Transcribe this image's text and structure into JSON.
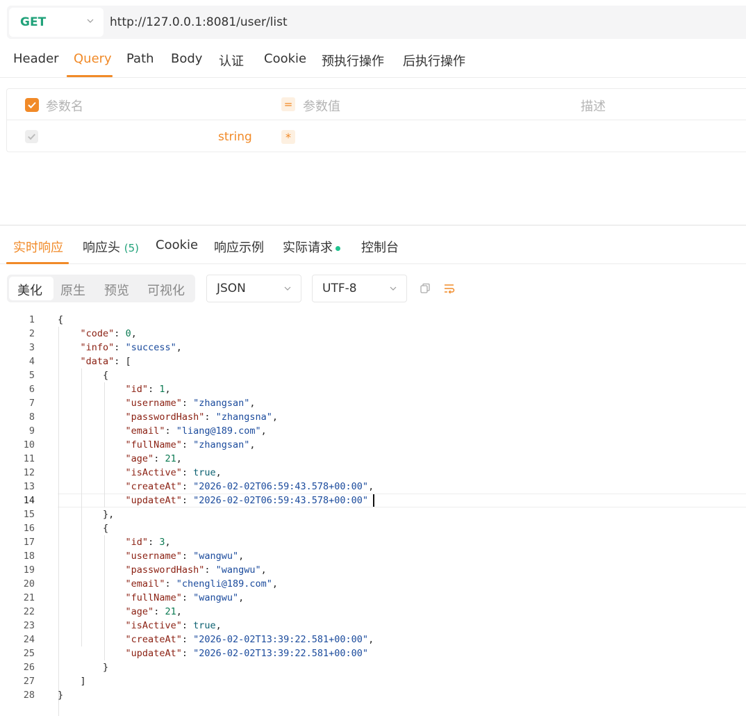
{
  "request": {
    "method": "GET",
    "url": "http://127.0.0.1:8081/user/list"
  },
  "request_tabs": [
    "Header",
    "Query",
    "Path",
    "Body",
    "认证",
    "Cookie",
    "预执行操作",
    "后执行操作"
  ],
  "request_tab_active": "Query",
  "query_table": {
    "col_name": "参数名",
    "col_value": "参数值",
    "col_desc": "描述",
    "eq_symbol": "=",
    "row_type": "string",
    "row_required": "*"
  },
  "response_tabs": {
    "realtime": "实时响应",
    "headers": "响应头",
    "headers_count": "(5)",
    "cookie": "Cookie",
    "example": "响应示例",
    "actual": "实际请求",
    "console": "控制台"
  },
  "view_modes": [
    "美化",
    "原生",
    "预览",
    "可视化"
  ],
  "view_mode_active": "美化",
  "format_select": "JSON",
  "encoding_select": "UTF-8",
  "colors": {
    "accent": "#f18a28",
    "method_green": "#21a27a"
  },
  "code_lines": [
    "{",
    "    \"code\": 0,",
    "    \"info\": \"success\",",
    "    \"data\": [",
    "        {",
    "            \"id\": 1,",
    "            \"username\": \"zhangsan\",",
    "            \"passwordHash\": \"zhangsna\",",
    "            \"email\": \"liang@189.com\",",
    "            \"fullName\": \"zhangsan\",",
    "            \"age\": 21,",
    "            \"isActive\": true,",
    "            \"createAt\": \"2026-02-02T06:59:43.578+00:00\",",
    "            \"updateAt\": \"2026-02-02T06:59:43.578+00:00\"",
    "        },",
    "        {",
    "            \"id\": 3,",
    "            \"username\": \"wangwu\",",
    "            \"passwordHash\": \"wangwu\",",
    "            \"email\": \"chengli@189.com\",",
    "            \"fullName\": \"wangwu\",",
    "            \"age\": 21,",
    "            \"isActive\": true,",
    "            \"createAt\": \"2026-02-02T13:39:22.581+00:00\",",
    "            \"updateAt\": \"2026-02-02T13:39:22.581+00:00\"",
    "        }",
    "    ]",
    "}"
  ],
  "current_line": 14
}
